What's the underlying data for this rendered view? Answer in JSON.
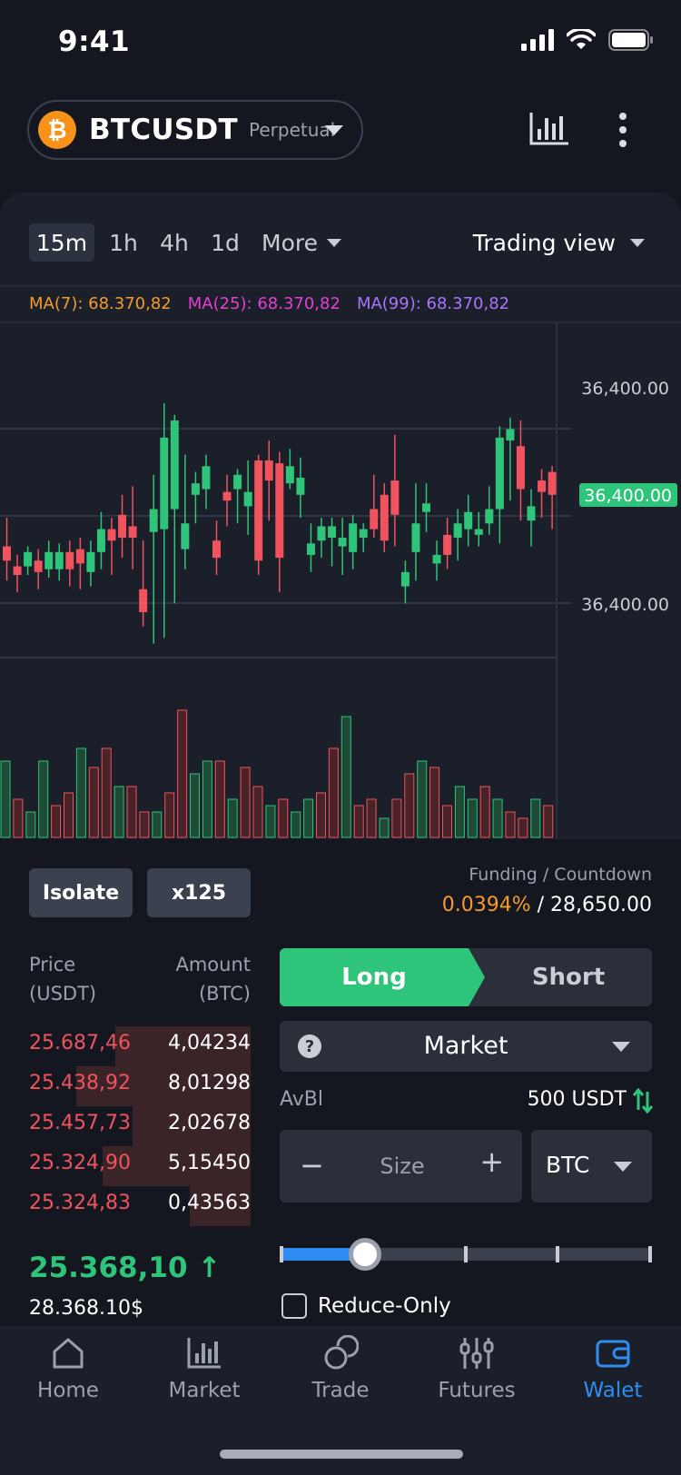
{
  "status": {
    "time": "9:41"
  },
  "header": {
    "pair": "BTCUSDT",
    "type": "Perpetual",
    "coin_symbol": "₿"
  },
  "chart": {
    "timeframes": [
      "15m",
      "1h",
      "4h",
      "1d"
    ],
    "active_timeframe": "15m",
    "more_label": "More",
    "view_label": "Trading view",
    "ma7": "MA(7): 68.370,82",
    "ma25": "MA(25): 68.370,82",
    "ma99": "MA(99): 68.370,82",
    "price_labels": [
      "36,400.00",
      "36,400.00",
      "36,400.00"
    ],
    "current_price_label": "36,400.00"
  },
  "chart_data": {
    "type": "candlestick",
    "candles": [
      [
        0.5,
        0.45,
        0.6,
        0.38
      ],
      [
        0.43,
        0.4,
        0.47,
        0.34
      ],
      [
        0.43,
        0.48,
        0.5,
        0.4
      ],
      [
        0.45,
        0.41,
        0.49,
        0.35
      ],
      [
        0.42,
        0.48,
        0.52,
        0.39
      ],
      [
        0.42,
        0.48,
        0.51,
        0.38
      ],
      [
        0.48,
        0.42,
        0.52,
        0.36
      ],
      [
        0.49,
        0.44,
        0.53,
        0.35
      ],
      [
        0.41,
        0.48,
        0.52,
        0.36
      ],
      [
        0.48,
        0.56,
        0.62,
        0.42
      ],
      [
        0.56,
        0.52,
        0.6,
        0.4
      ],
      [
        0.61,
        0.53,
        0.68,
        0.46
      ],
      [
        0.57,
        0.53,
        0.71,
        0.42
      ],
      [
        0.35,
        0.27,
        0.52,
        0.22
      ],
      [
        0.55,
        0.63,
        0.75,
        0.16
      ],
      [
        0.56,
        0.88,
        1.0,
        0.18
      ],
      [
        0.63,
        0.94,
        0.96,
        0.3
      ],
      [
        0.49,
        0.58,
        0.82,
        0.42
      ],
      [
        0.68,
        0.72,
        0.76,
        0.58
      ],
      [
        0.7,
        0.78,
        0.82,
        0.63
      ],
      [
        0.52,
        0.46,
        0.59,
        0.4
      ],
      [
        0.69,
        0.66,
        0.75,
        0.57
      ],
      [
        0.7,
        0.75,
        0.77,
        0.58
      ],
      [
        0.64,
        0.69,
        0.8,
        0.54
      ],
      [
        0.8,
        0.45,
        0.82,
        0.4
      ],
      [
        0.8,
        0.73,
        0.87,
        0.59
      ],
      [
        0.79,
        0.46,
        0.83,
        0.34
      ],
      [
        0.72,
        0.78,
        0.84,
        0.7
      ],
      [
        0.68,
        0.74,
        0.81,
        0.6
      ],
      [
        0.47,
        0.51,
        0.58,
        0.41
      ],
      [
        0.52,
        0.57,
        0.6,
        0.46
      ],
      [
        0.53,
        0.57,
        0.6,
        0.43
      ],
      [
        0.5,
        0.53,
        0.6,
        0.4
      ],
      [
        0.48,
        0.58,
        0.61,
        0.42
      ],
      [
        0.53,
        0.56,
        0.58,
        0.48
      ],
      [
        0.63,
        0.56,
        0.75,
        0.53
      ],
      [
        0.68,
        0.52,
        0.72,
        0.48
      ],
      [
        0.73,
        0.61,
        0.89,
        0.5
      ],
      [
        0.36,
        0.41,
        0.45,
        0.3
      ],
      [
        0.48,
        0.58,
        0.72,
        0.38
      ],
      [
        0.62,
        0.65,
        0.72,
        0.55
      ],
      [
        0.44,
        0.47,
        0.52,
        0.38
      ],
      [
        0.54,
        0.47,
        0.6,
        0.42
      ],
      [
        0.53,
        0.58,
        0.63,
        0.45
      ],
      [
        0.56,
        0.62,
        0.68,
        0.5
      ],
      [
        0.54,
        0.56,
        0.62,
        0.5
      ],
      [
        0.58,
        0.63,
        0.71,
        0.54
      ],
      [
        0.63,
        0.88,
        0.92,
        0.51
      ],
      [
        0.87,
        0.91,
        0.95,
        0.66
      ],
      [
        0.85,
        0.7,
        0.94,
        0.59
      ],
      [
        0.59,
        0.64,
        0.7,
        0.5
      ],
      [
        0.73,
        0.69,
        0.77,
        0.6
      ],
      [
        0.76,
        0.68,
        0.78,
        0.56
      ]
    ],
    "volume": [
      0.6,
      0.3,
      0.2,
      0.6,
      0.25,
      0.35,
      0.7,
      0.55,
      0.7,
      0.4,
      0.4,
      0.2,
      0.2,
      0.35,
      1.0,
      0.5,
      0.6,
      0.6,
      0.3,
      0.55,
      0.4,
      0.25,
      0.3,
      0.2,
      0.3,
      0.35,
      0.7,
      0.95,
      0.25,
      0.3,
      0.15,
      0.3,
      0.5,
      0.6,
      0.55,
      0.25,
      0.4,
      0.3,
      0.4,
      0.3,
      0.2,
      0.15,
      0.3,
      0.25,
      0.3,
      0.1,
      0.1,
      0.15,
      0.5,
      0.6,
      0.7,
      0.4,
      0.2,
      0.25,
      0.3,
      0.35,
      0.45,
      0.65,
      0.3,
      0.2,
      0.2
    ]
  },
  "controls": {
    "margin_mode": "Isolate",
    "leverage": "x125",
    "funding_label": "Funding / Countdown",
    "funding_rate": "0.0394%",
    "funding_countdown": " / 28,650.00"
  },
  "orderbook": {
    "price_header": [
      "Price",
      "(USDT)"
    ],
    "amount_header": [
      "Amount",
      "(BTC)"
    ],
    "asks": [
      {
        "price": "25.687,46",
        "amount": "4,04234",
        "depth": 0.62
      },
      {
        "price": "25.438,92",
        "amount": "8,01298",
        "depth": 0.8
      },
      {
        "price": "25.457,73",
        "amount": "2,02678",
        "depth": 0.54
      },
      {
        "price": "25.324,90",
        "amount": "5,15450",
        "depth": 0.68
      },
      {
        "price": "25.324,83",
        "amount": "0,43563",
        "depth": 0.28
      }
    ],
    "last_price": "25.368,10 ↑",
    "last_usd": "28.368.10$"
  },
  "order": {
    "long_label": "Long",
    "short_label": "Short",
    "type_label": "Market",
    "avbl_label": "AvBl",
    "avbl_value": "500 USDT",
    "size_placeholder": "Size",
    "unit": "BTC",
    "slider_percent": 23,
    "reduce_only_label": "Reduce-Only"
  },
  "nav": {
    "items": [
      "Home",
      "Market",
      "Trade",
      "Futures",
      "Walet"
    ],
    "active": "Walet"
  },
  "colors": {
    "up": "#2ec47a",
    "down": "#f0535d",
    "accent": "#2f8cf0",
    "funding": "#f49b2b"
  }
}
